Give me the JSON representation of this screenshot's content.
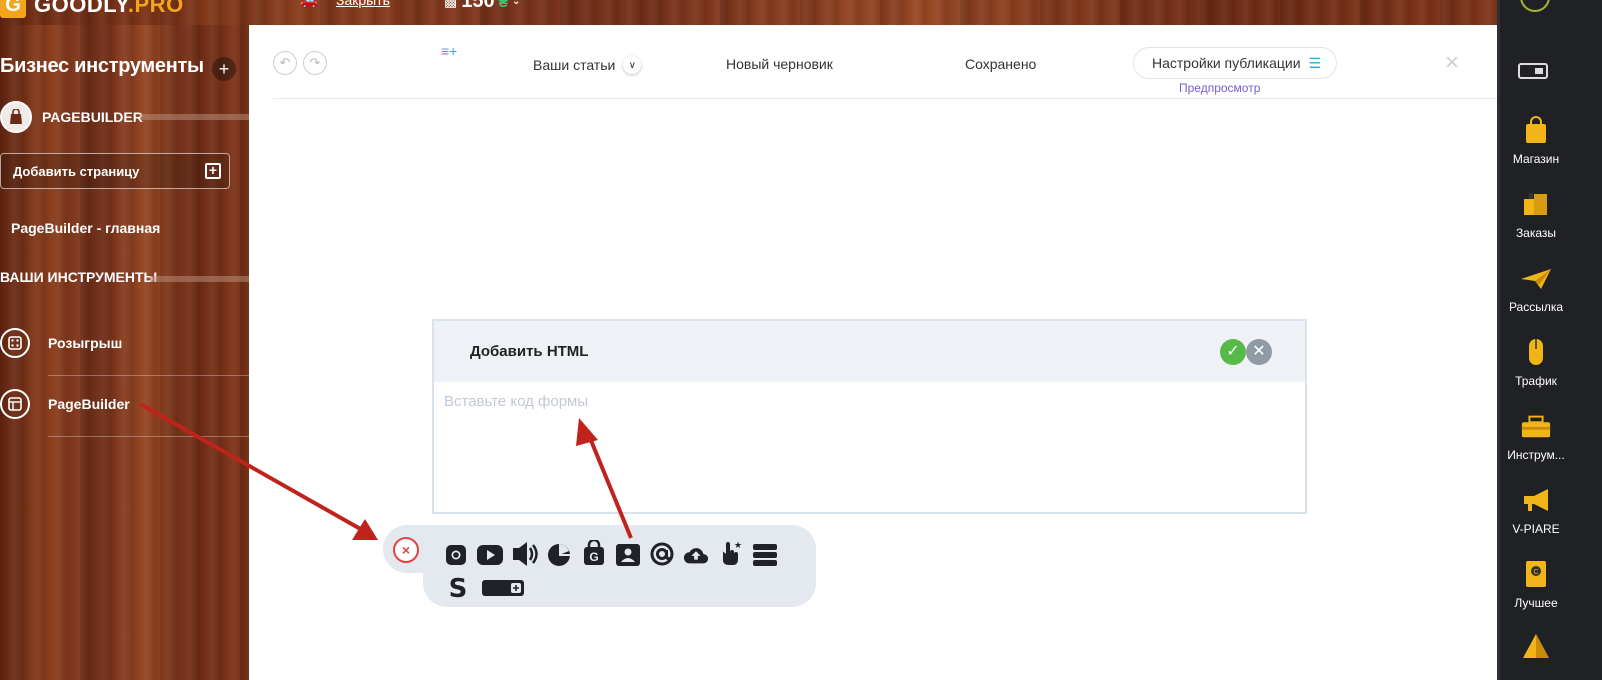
{
  "topbar": {
    "logo_letter": "G",
    "logo_text_main": "GOODLY",
    "logo_text_suffix": ".PRO",
    "link_text": "Закрыть",
    "balance": "150",
    "coin_symbol": "₴"
  },
  "sidebar": {
    "title": "Бизнес инструменты",
    "plus": "+",
    "pagebuilder_section": "PAGEBUILDER",
    "add_page_label": "Добавить страницу",
    "main_page_link": "PageBuilder - главная",
    "tools_section": "ВАШИ ИНСТРУМЕНТЫ",
    "tools": [
      {
        "label": "Розыгрыш",
        "icon": "dice-icon"
      },
      {
        "label": "PageBuilder",
        "icon": "layout-icon"
      }
    ]
  },
  "editor": {
    "undo": "↶",
    "redo": "↷",
    "articles_label": "Ваши статьи",
    "draft_label": "Новый черновик",
    "saved_label": "Сохранено",
    "publish_settings_label": "Настройки публикации",
    "preview_label": "Предпросмотр",
    "close": "×"
  },
  "html_modal": {
    "title": "Добавить HTML",
    "confirm": "✓",
    "cancel": "✕",
    "placeholder": "Вставьте код формы"
  },
  "block_toolbar": {
    "close": "×",
    "icons": [
      "instagram-icon",
      "youtube-icon",
      "audio-icon",
      "chart-pie-icon",
      "shop-bag-icon",
      "contact-card-icon",
      "at-email-icon",
      "cloud-upload-icon",
      "tap-star-icon",
      "menu-lines-icon",
      "skype-icon",
      "button-add-icon"
    ]
  },
  "dock": {
    "items": [
      {
        "label": "Магазин",
        "icon": "shopping-bag-icon"
      },
      {
        "label": "Заказы",
        "icon": "boxes-icon"
      },
      {
        "label": "Рассылка",
        "icon": "paper-plane-icon"
      },
      {
        "label": "Трафик",
        "icon": "mouse-icon"
      },
      {
        "label": "Инструм...",
        "icon": "toolbox-icon"
      },
      {
        "label": "V-PIARE",
        "icon": "megaphone-icon"
      },
      {
        "label": "Лучшее",
        "icon": "best-badge-icon"
      }
    ]
  },
  "colors": {
    "accent": "#3aa3e3",
    "preview_link": "#7a5bd1",
    "ok_green": "#57b947",
    "arrow_red": "#c0231c"
  }
}
